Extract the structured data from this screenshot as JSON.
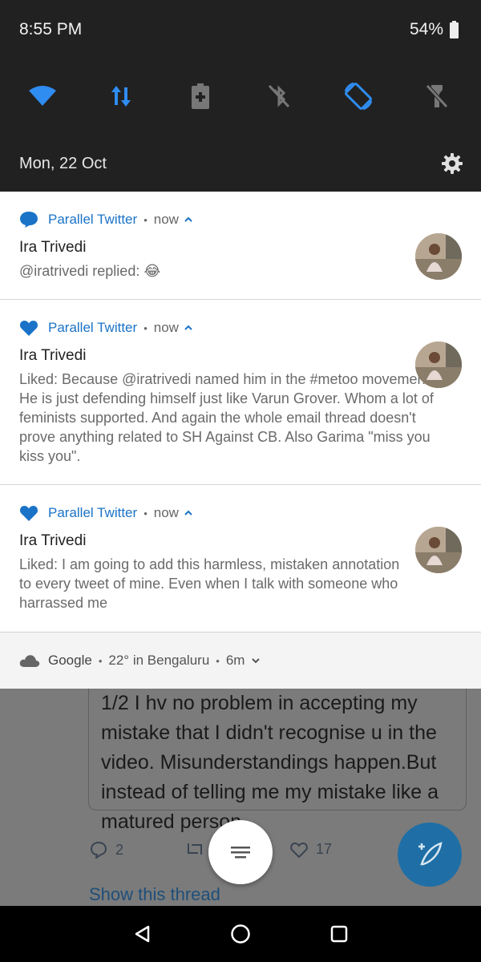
{
  "status_bar": {
    "time": "8:55 PM",
    "battery": "54%"
  },
  "quick_settings": {
    "tiles": [
      {
        "icon": "wifi-icon",
        "active": true
      },
      {
        "icon": "mobile-data-icon",
        "active": true
      },
      {
        "icon": "battery-saver-icon",
        "active": false
      },
      {
        "icon": "bluetooth-off-icon",
        "active": false
      },
      {
        "icon": "auto-rotate-icon",
        "active": true
      },
      {
        "icon": "flashlight-off-icon",
        "active": false
      }
    ],
    "date": "Mon, 22 Oct"
  },
  "colors": {
    "accent": "#1a73c7",
    "qs_active": "#2f8cf0",
    "qs_inactive": "#7a7a7a"
  },
  "notifications": [
    {
      "app": "Parallel Twitter",
      "time": "now",
      "title": "Ira Trivedi",
      "body": "@iratrivedi replied: 😂",
      "icon": "reply-bubble-icon"
    },
    {
      "app": "Parallel Twitter",
      "time": "now",
      "title": "Ira Trivedi",
      "body": "Liked: Because @iratrivedi named him in the #metoo movement. He is just defending himself just like Varun Grover. Whom a lot of feminists supported. And again the whole email thread doesn't prove anything related to SH Against CB. Also Garima \"miss you kiss you\".",
      "icon": "heart-icon"
    },
    {
      "app": "Parallel Twitter",
      "time": "now",
      "title": "Ira Trivedi",
      "body": "Liked: I am going to add this harmless, mistaken annotation to every tweet of mine. Even when I talk with someone who harrassed me",
      "icon": "heart-icon"
    }
  ],
  "google_notification": {
    "app": "Google",
    "weather": "22° in Bengaluru",
    "time": "6m"
  },
  "background_tweet": {
    "text": "1/2 I hv no problem in accepting my mistake that I didn't recognise u in the video. Misunderstandings happen.But instead of telling me my mistake like a matured person,",
    "replies": "2",
    "likes": "17",
    "show_thread": "Show this thread"
  }
}
